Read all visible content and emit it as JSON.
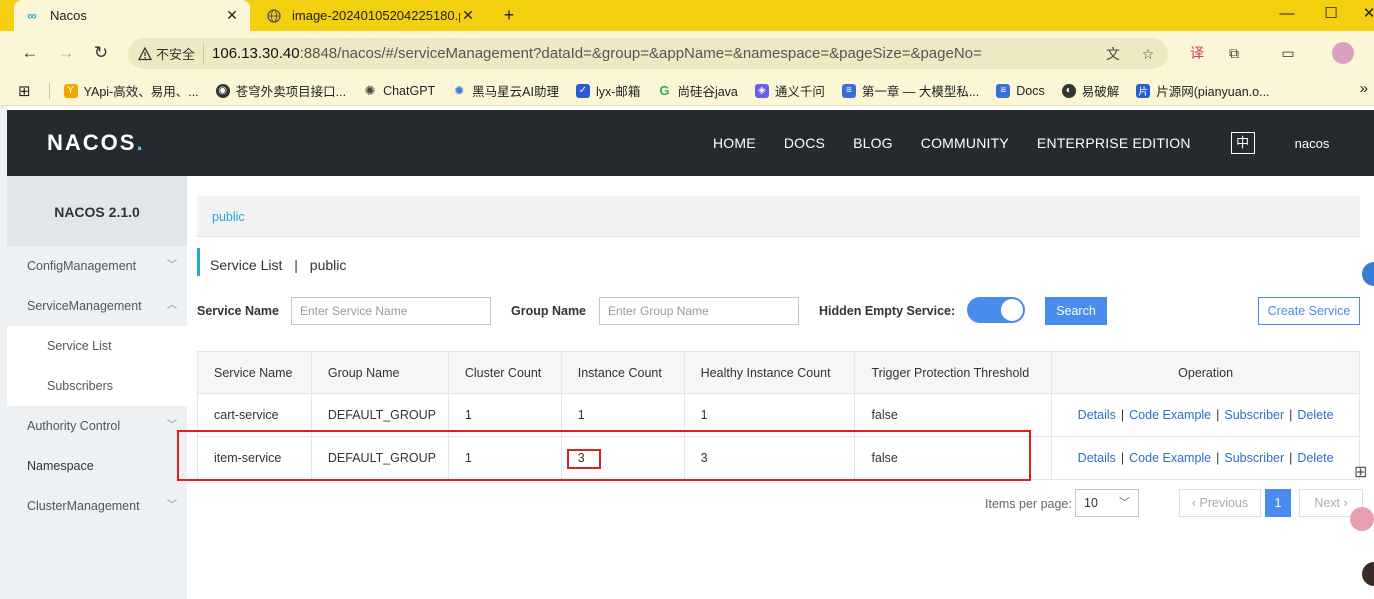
{
  "browser": {
    "tabs": [
      {
        "title": "Nacos",
        "active": true
      },
      {
        "title": "image-20240105204225180.p",
        "active": false
      }
    ],
    "address": {
      "security_label": "不安全",
      "host": "106.13.30.40",
      "path": ":8848/nacos/#/serviceManagement?dataId=&group=&appName=&namespace=&pageSize=&pageNo="
    },
    "bookmarks": [
      {
        "label": "YApi-高效、易用、...",
        "color": "#f0a500"
      },
      {
        "label": "苍穹外卖项目接口...",
        "color": "#333333"
      },
      {
        "label": "ChatGPT",
        "color": "#444444"
      },
      {
        "label": "黑马星云AI助理",
        "color": "#4a7fd6"
      },
      {
        "label": "lyx-邮箱",
        "color": "#2a5bd7"
      },
      {
        "label": "尚硅谷java",
        "color": "#2bb24c"
      },
      {
        "label": "通义千问",
        "color": "#6b5cf0"
      },
      {
        "label": "第一章 — 大模型私...",
        "color": "#3a6fd8"
      },
      {
        "label": "Docs",
        "color": "#3a6fd8"
      },
      {
        "label": "易破解",
        "color": "#333333"
      },
      {
        "label": "片源网(pianyuan.o...",
        "color": "#2a5bd7"
      }
    ]
  },
  "topnav": {
    "logo": "NACOS",
    "links": [
      "HOME",
      "DOCS",
      "BLOG",
      "COMMUNITY",
      "ENTERPRISE EDITION"
    ],
    "lang": "中",
    "user": "nacos"
  },
  "sidebar": {
    "title": "NACOS 2.1.0",
    "items": [
      {
        "label": "ConfigManagement"
      },
      {
        "label": "ServiceManagement"
      },
      {
        "label": "Service List"
      },
      {
        "label": "Subscribers"
      },
      {
        "label": "Authority Control"
      },
      {
        "label": "Namespace"
      },
      {
        "label": "ClusterManagement"
      }
    ]
  },
  "main": {
    "namespace_tab": "public",
    "header": {
      "title": "Service List",
      "sep": "|",
      "namespace": "public"
    },
    "filters": {
      "service_name_label": "Service Name",
      "service_name_placeholder": "Enter Service Name",
      "group_name_label": "Group Name",
      "group_name_placeholder": "Enter Group Name",
      "hidden_empty_label": "Hidden Empty Service:",
      "hidden_empty_on": true,
      "search_label": "Search",
      "create_label": "Create Service"
    },
    "table": {
      "columns": [
        "Service Name",
        "Group Name",
        "Cluster Count",
        "Instance Count",
        "Healthy Instance Count",
        "Trigger Protection Threshold",
        "Operation"
      ],
      "rows": [
        {
          "service": "cart-service",
          "group": "DEFAULT_GROUP",
          "clusters": "1",
          "instances": "1",
          "healthy": "1",
          "threshold": "false"
        },
        {
          "service": "item-service",
          "group": "DEFAULT_GROUP",
          "clusters": "1",
          "instances": "3",
          "healthy": "3",
          "threshold": "false"
        }
      ],
      "ops": [
        "Details",
        "Code Example",
        "Subscriber",
        "Delete"
      ]
    },
    "pagination": {
      "items_label": "Items per page:",
      "page_size": "10",
      "prev_label": "Previous",
      "current_page": "1",
      "next_label": "Next"
    }
  }
}
